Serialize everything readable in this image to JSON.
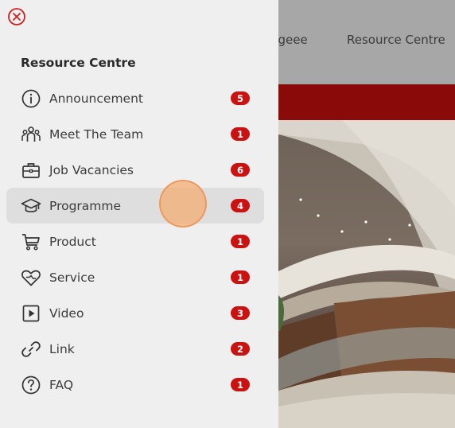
{
  "background_nav": {
    "items": [
      {
        "label": "ngeee"
      },
      {
        "label": "Resource Centre"
      }
    ]
  },
  "drawer": {
    "title": "Resource Centre",
    "close_icon": "close-circle-icon",
    "active_item": "Programme",
    "items": [
      {
        "label": "Announcement",
        "icon": "info-icon",
        "count": "5"
      },
      {
        "label": "Meet The Team",
        "icon": "team-icon",
        "count": "1"
      },
      {
        "label": "Job Vacancies",
        "icon": "briefcase-icon",
        "count": "6"
      },
      {
        "label": "Programme",
        "icon": "graduation-cap-icon",
        "count": "4"
      },
      {
        "label": "Product",
        "icon": "cart-icon",
        "count": "1"
      },
      {
        "label": "Service",
        "icon": "heart-hand-icon",
        "count": "1"
      },
      {
        "label": "Video",
        "icon": "play-icon",
        "count": "3"
      },
      {
        "label": "Link",
        "icon": "link-icon",
        "count": "2"
      },
      {
        "label": "FAQ",
        "icon": "question-icon",
        "count": "1"
      }
    ]
  },
  "colors": {
    "accent_red": "#cc1111",
    "header_red_bar": "#8a0a0a",
    "drawer_bg": "#efefef",
    "active_item_bg": "#dedede"
  }
}
